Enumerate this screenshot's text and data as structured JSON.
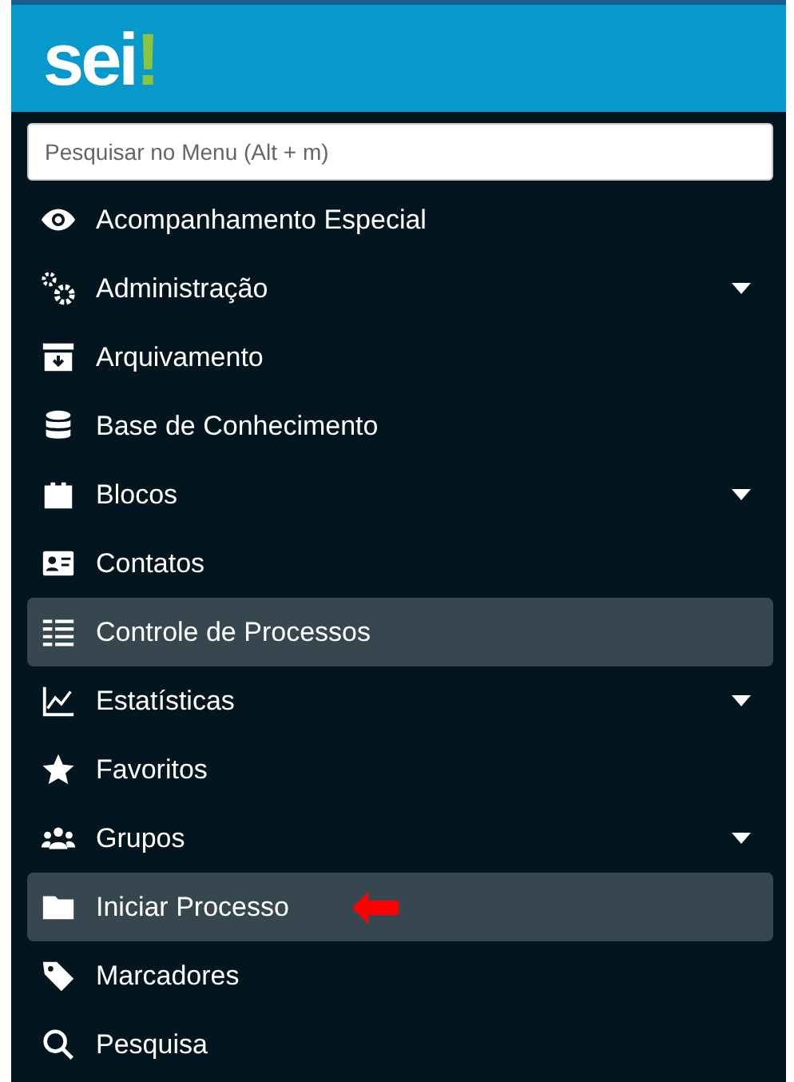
{
  "logo": "sei!",
  "search": {
    "placeholder": "Pesquisar no Menu (Alt + m)"
  },
  "menu": [
    {
      "label": "Acompanhamento Especial",
      "expandable": false,
      "selected": false,
      "marked": false
    },
    {
      "label": "Administração",
      "expandable": true,
      "selected": false,
      "marked": false
    },
    {
      "label": "Arquivamento",
      "expandable": false,
      "selected": false,
      "marked": false
    },
    {
      "label": "Base de Conhecimento",
      "expandable": false,
      "selected": false,
      "marked": false
    },
    {
      "label": "Blocos",
      "expandable": true,
      "selected": false,
      "marked": false
    },
    {
      "label": "Contatos",
      "expandable": false,
      "selected": false,
      "marked": false
    },
    {
      "label": "Controle de Processos",
      "expandable": false,
      "selected": true,
      "marked": false
    },
    {
      "label": "Estatísticas",
      "expandable": true,
      "selected": false,
      "marked": false
    },
    {
      "label": "Favoritos",
      "expandable": false,
      "selected": false,
      "marked": false
    },
    {
      "label": "Grupos",
      "expandable": true,
      "selected": false,
      "marked": false
    },
    {
      "label": "Iniciar Processo",
      "expandable": false,
      "selected": true,
      "marked": true
    },
    {
      "label": "Marcadores",
      "expandable": false,
      "selected": false,
      "marked": false
    },
    {
      "label": "Pesquisa",
      "expandable": false,
      "selected": false,
      "marked": false
    }
  ]
}
